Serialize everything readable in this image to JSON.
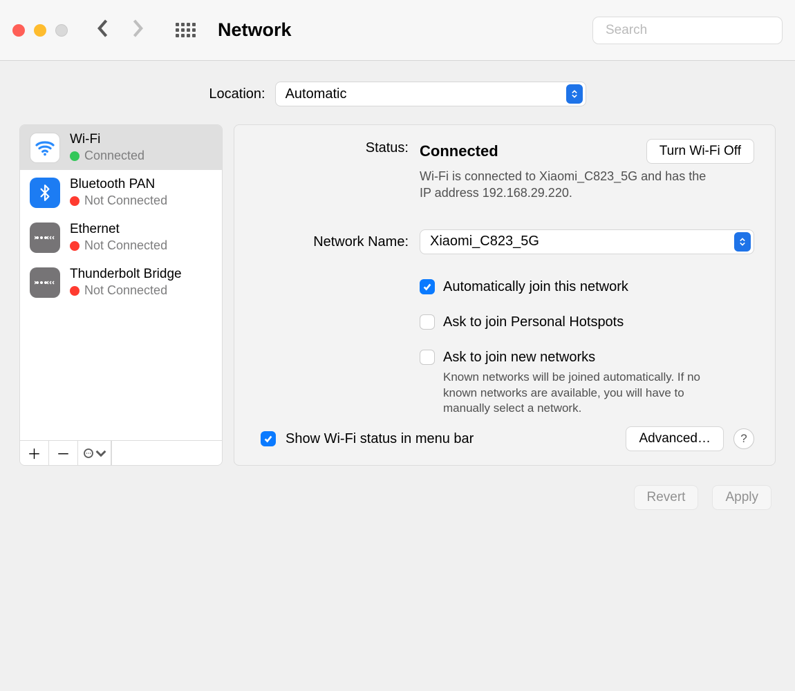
{
  "toolbar": {
    "title": "Network",
    "search_placeholder": "Search"
  },
  "location": {
    "label": "Location:",
    "value": "Automatic"
  },
  "sidebar": {
    "items": [
      {
        "name": "Wi-Fi",
        "status": "Connected",
        "status_color": "green",
        "icon": "wifi",
        "selected": true
      },
      {
        "name": "Bluetooth PAN",
        "status": "Not Connected",
        "status_color": "red",
        "icon": "bluetooth",
        "selected": false
      },
      {
        "name": "Ethernet",
        "status": "Not Connected",
        "status_color": "red",
        "icon": "ethernet",
        "selected": false
      },
      {
        "name": "Thunderbolt Bridge",
        "status": "Not Connected",
        "status_color": "red",
        "icon": "ethernet",
        "selected": false
      }
    ]
  },
  "detail": {
    "status_label": "Status:",
    "status_value": "Connected",
    "toggle_button": "Turn Wi-Fi Off",
    "status_desc": "Wi-Fi is connected to Xiaomi_C823_5G and has the IP address 192.168.29.220.",
    "network_label": "Network Name:",
    "network_value": "Xiaomi_C823_5G",
    "auto_join_label": "Automatically join this network",
    "auto_join_checked": true,
    "ask_hotspot_label": "Ask to join Personal Hotspots",
    "ask_hotspot_checked": false,
    "ask_new_label": "Ask to join new networks",
    "ask_new_checked": false,
    "ask_new_desc": "Known networks will be joined automatically. If no known networks are available, you will have to manually select a network.",
    "show_menubar_label": "Show Wi-Fi status in menu bar",
    "show_menubar_checked": true,
    "advanced_button": "Advanced…",
    "help_button": "?"
  },
  "actions": {
    "revert": "Revert",
    "apply": "Apply"
  }
}
